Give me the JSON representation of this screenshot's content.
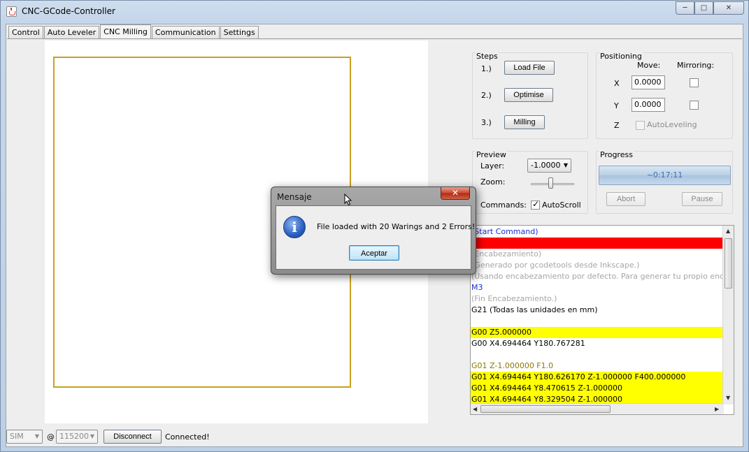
{
  "window": {
    "title": "CNC-GCode-Controller",
    "controls": [
      "─",
      "□",
      "✕"
    ]
  },
  "tabs": [
    "Control",
    "Auto Leveler",
    "CNC Milling",
    "Communication",
    "Settings"
  ],
  "active_tab": "CNC Milling",
  "steps": {
    "title": "Steps",
    "items": [
      {
        "num": "1.)",
        "button": "Load File"
      },
      {
        "num": "2.)",
        "button": "Optimise"
      },
      {
        "num": "3.)",
        "button": "Milling"
      }
    ]
  },
  "positioning": {
    "title": "Positioning",
    "move_header": "Move:",
    "mirroring_header": "Mirroring:",
    "x_label": "X",
    "x_value": "0.0000",
    "y_label": "Y",
    "y_value": "0.0000",
    "z_label": "Z",
    "autoleveling_label": "AutoLeveling"
  },
  "preview": {
    "title": "Preview",
    "layer_label": "Layer:",
    "layer_value": "-1.0000",
    "zoom_label": "Zoom:",
    "zoom_level": 0.45,
    "commands_label": "Commands:",
    "autoscroll_label": "AutoScroll",
    "autoscroll_checked": true
  },
  "progress": {
    "title": "Progress",
    "time_text": "~0:17:11",
    "abort_label": "Abort",
    "pause_label": "Pause"
  },
  "gcode_lines": [
    {
      "text": "(Start Command)",
      "style": "blue"
    },
    {
      "text": "",
      "style": "red-bg"
    },
    {
      "text": "(Encabezamiento)",
      "style": "gray"
    },
    {
      "text": "(Generado por gcodetools desde Inkscape.)",
      "style": "gray"
    },
    {
      "text": "(Usando encabezamiento por defecto. Para generar tu propio encabezamie",
      "style": "gray"
    },
    {
      "text": "M3",
      "style": "blue"
    },
    {
      "text": "(Fin Encabezamiento.)",
      "style": "gray"
    },
    {
      "text": "G21 (Todas las unidades en mm)",
      "style": "plain"
    },
    {
      "text": "",
      "style": "plain"
    },
    {
      "text": "G00 Z5.000000",
      "style": "yellow-bg"
    },
    {
      "text": "G00 X4.694464 Y180.767281",
      "style": "plain"
    },
    {
      "text": "",
      "style": "plain"
    },
    {
      "text": "G01 Z-1.000000 F1.0",
      "style": "olive"
    },
    {
      "text": "G01 X4.694464 Y180.626170 Z-1.000000 F400.000000",
      "style": "yellow-bg"
    },
    {
      "text": "G01 X4.694464 Y8.470615 Z-1.000000",
      "style": "yellow-bg"
    },
    {
      "text": "G01 X4.694464 Y8.329504 Z-1.000000",
      "style": "yellow-bg"
    }
  ],
  "statusbar": {
    "port": "SIM",
    "at": "@",
    "baud": "115200",
    "disconnect_label": "Disconnect",
    "status": "Connected!"
  },
  "dialog": {
    "title": "Mensaje",
    "close_glyph": "✕",
    "message": "File loaded with 20 Warings and 2 Errors!",
    "button": "Aceptar",
    "icon_glyph": "i"
  },
  "colors": {
    "board_outline": "#c8a020",
    "highlight_yellow": "#ffff00",
    "highlight_red": "#ff0000"
  }
}
